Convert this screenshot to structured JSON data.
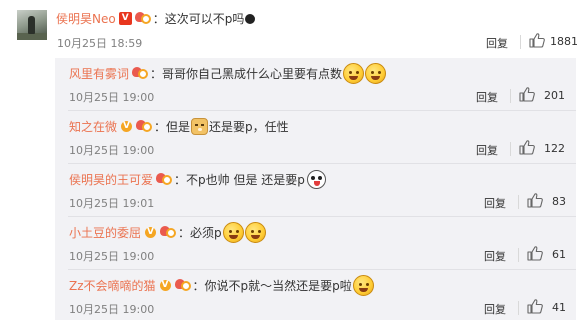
{
  "main_comment": {
    "user": "侯明昊Neo",
    "badge": "V",
    "text": "这次可以不p吗",
    "time": "10月25日 18:59",
    "reply_label": "回复",
    "likes": "1881"
  },
  "replies": [
    {
      "user": "风里有雾词",
      "text": "哥哥你自己黑成什么心里要有点数",
      "time": "10月25日 19:00",
      "reply_label": "回复",
      "likes": "201"
    },
    {
      "user": "知之在微",
      "text_a": "但是",
      "text_b": "还是要p，任性",
      "time": "10月25日 19:00",
      "reply_label": "回复",
      "likes": "122"
    },
    {
      "user": "侯明昊的王可爱",
      "text": "不p也帅 但是 还是要p",
      "time": "10月25日 19:01",
      "reply_label": "回复",
      "likes": "83"
    },
    {
      "user": "小土豆的委屈",
      "text": "必须p",
      "time": "10月25日 19:00",
      "reply_label": "回复",
      "likes": "61"
    },
    {
      "user": "Zz不会嘀嘀的猫",
      "text": "你说不p就～当然还是要p啦",
      "time": "10月25日 19:00",
      "reply_label": "回复",
      "likes": "41"
    }
  ],
  "separator": "：",
  "icons": {
    "like": "thumbs-up-icon",
    "verified": "verified-v-icon",
    "fan_badge": "fan-badge-icon"
  },
  "colors": {
    "username": "#eb7350",
    "verified_red": "#e8361e",
    "verified_gold": "#f5a623",
    "reply_bg": "#f2f2f5",
    "time": "#808080"
  }
}
